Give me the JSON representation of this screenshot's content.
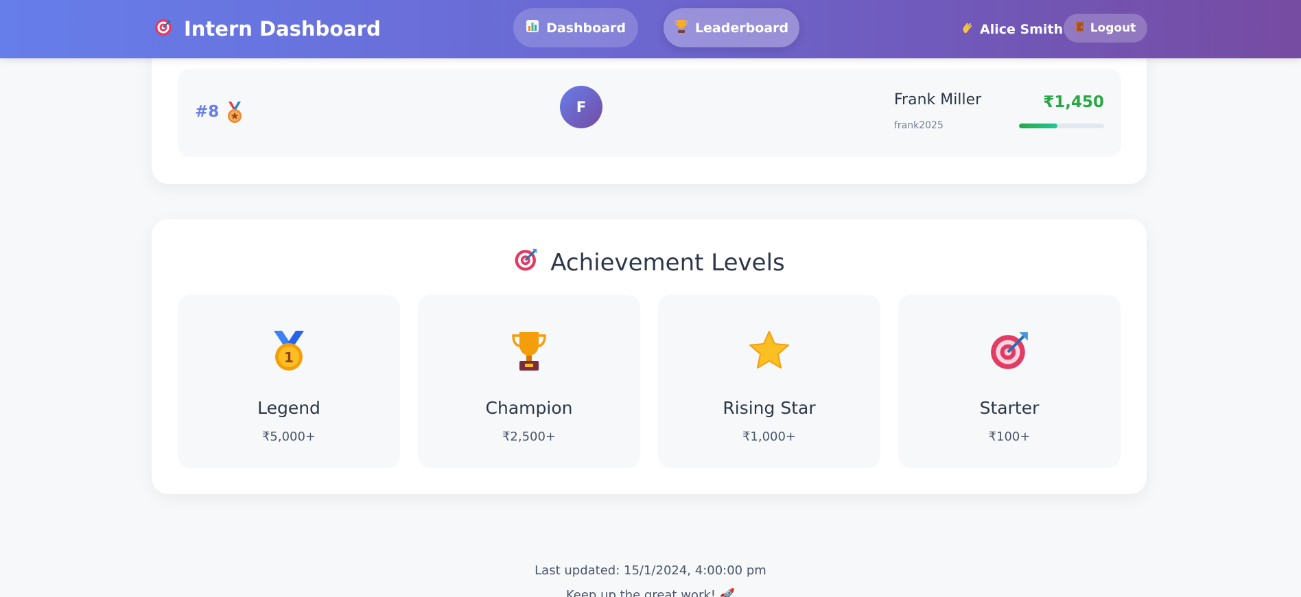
{
  "header": {
    "brand_icon": "target-icon",
    "title": "Intern Dashboard",
    "nav": [
      {
        "label": "Dashboard",
        "icon": "bar-chart-icon"
      },
      {
        "label": "Leaderboard",
        "icon": "trophy-icon"
      }
    ],
    "user_greeting_icon": "waving-hand-icon",
    "user_name": "Alice Smith",
    "logout_icon": "door-icon",
    "logout_label": "Logout",
    "gradient": [
      "#667eea",
      "#764ba2"
    ]
  },
  "leaderboard": {
    "row": {
      "rank": "#8",
      "medal_icon": "sports-medal-icon",
      "avatar_letter": "F",
      "name": "Frank Miller",
      "username": "frank2025",
      "amount": "₹1,450",
      "progress_fraction": 0.45,
      "amount_color": "#28a745"
    }
  },
  "achievements": {
    "title": "Achievement Levels",
    "title_icon": "target-icon",
    "levels": [
      {
        "name": "Legend",
        "threshold": "₹5,000+",
        "icon": "first-place-medal-icon"
      },
      {
        "name": "Champion",
        "threshold": "₹2,500+",
        "icon": "trophy-icon"
      },
      {
        "name": "Rising Star",
        "threshold": "₹1,000+",
        "icon": "star-icon"
      },
      {
        "name": "Starter",
        "threshold": "₹100+",
        "icon": "target-icon"
      }
    ]
  },
  "footer": {
    "last_updated": "Last updated: 15/1/2024, 4:00:00 pm",
    "message": "Keep up the great work! 🚀"
  }
}
